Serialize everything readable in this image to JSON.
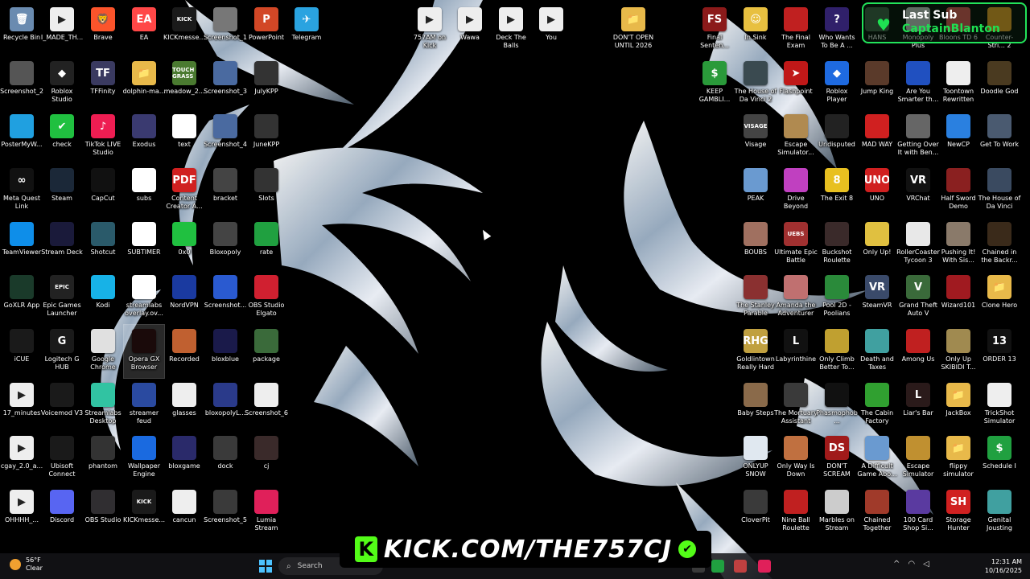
{
  "overlay": {
    "last_sub_title": "Last Sub",
    "last_sub_name": "CaptainBlanton",
    "banner_logo": "K",
    "banner_url": "KICK.COM/THE757CJ"
  },
  "taskbar": {
    "weather_temp": "56°F",
    "weather_cond": "Clear",
    "search_placeholder": "Search",
    "time": "12:31 AM",
    "date": "10/16/2025"
  },
  "colors": {
    "accent_green": "#53fc18",
    "taskbar_bg": "#141418",
    "start_blue": "#4cc2ff"
  },
  "icons": [
    {
      "label": "Recycle Bin",
      "glyph": "🗑",
      "color": "#6a8bb0"
    },
    {
      "label": "I_MADE_TH...",
      "glyph": "▶",
      "color": "#eeeeee"
    },
    {
      "label": "Brave",
      "glyph": "🦁",
      "color": "#fb542b"
    },
    {
      "label": "EA",
      "glyph": "EA",
      "color": "#ff4747"
    },
    {
      "label": "KICKmesse...",
      "glyph": "KICK",
      "color": "#1a1a1a"
    },
    {
      "label": "Screenshot_1",
      "glyph": "",
      "color": "#777777"
    },
    {
      "label": "PowerPoint",
      "glyph": "P",
      "color": "#d24726"
    },
    {
      "label": "Telegram",
      "glyph": "✈",
      "color": "#2aa3e0"
    },
    {
      "label": "757AM on Kick",
      "glyph": "▶",
      "color": "#eeeeee"
    },
    {
      "label": "Wawa",
      "glyph": "▶",
      "color": "#eeeeee"
    },
    {
      "label": "Deck The Balls",
      "glyph": "▶",
      "color": "#eeeeee"
    },
    {
      "label": "You",
      "glyph": "▶",
      "color": "#eeeeee"
    },
    {
      "label": "DON'T OPEN UNTIL 2026",
      "glyph": "📁",
      "color": "#e8b94a"
    },
    {
      "label": "Final Senten...",
      "glyph": "FS",
      "color": "#8b1a1a"
    },
    {
      "label": "In Sink",
      "glyph": "☺",
      "color": "#e8c040"
    },
    {
      "label": "The Final Exam",
      "glyph": "",
      "color": "#c02020"
    },
    {
      "label": "Who Wants To Be A ...",
      "glyph": "?",
      "color": "#30206a"
    },
    {
      "label": "HANS",
      "glyph": "",
      "color": "#3a5a40"
    },
    {
      "label": "Monopoly Plus",
      "glyph": "",
      "color": "#c8c8c8"
    },
    {
      "label": "Bloons TD 6",
      "glyph": "",
      "color": "#e05050"
    },
    {
      "label": "Counter-Stri... 2",
      "glyph": "",
      "color": "#f0a020"
    },
    {
      "label": "Screenshot_2",
      "glyph": "",
      "color": "#555555"
    },
    {
      "label": "Roblox Studio",
      "glyph": "◆",
      "color": "#222222"
    },
    {
      "label": "TFFinity",
      "glyph": "TF",
      "color": "#3a3a60"
    },
    {
      "label": "dolphin-ma...",
      "glyph": "📁",
      "color": "#e8b94a"
    },
    {
      "label": "meadow_2...",
      "glyph": "TOUCH GRASS",
      "color": "#4a7a30"
    },
    {
      "label": "Screenshot_3",
      "glyph": "",
      "color": "#4a6aa0"
    },
    {
      "label": "JulyKPP",
      "glyph": "",
      "color": "#333333"
    },
    {
      "label": "KEEP GAMBLI...",
      "glyph": "$",
      "color": "#2a9a3a"
    },
    {
      "label": "The House of Da Vinci 2",
      "glyph": "",
      "color": "#3a4a50"
    },
    {
      "label": "Flashpoint",
      "glyph": "➤",
      "color": "#c01818"
    },
    {
      "label": "Roblox Player",
      "glyph": "◆",
      "color": "#1e6ae0"
    },
    {
      "label": "Jump King",
      "glyph": "",
      "color": "#5a3a2a"
    },
    {
      "label": "Are You Smarter th...",
      "glyph": "",
      "color": "#2050c0"
    },
    {
      "label": "Toontown Rewritten",
      "glyph": "",
      "color": "#eeeeee"
    },
    {
      "label": "Doodle God",
      "glyph": "",
      "color": "#4a3a20"
    },
    {
      "label": "PosterMyW...",
      "glyph": "",
      "color": "#20a0e0"
    },
    {
      "label": "check",
      "glyph": "✔",
      "color": "#20c040"
    },
    {
      "label": "TikTok LIVE Studio",
      "glyph": "♪",
      "color": "#ee1d52"
    },
    {
      "label": "Exodus",
      "glyph": "",
      "color": "#3a3a70"
    },
    {
      "label": "text",
      "glyph": "",
      "color": "#ffffff"
    },
    {
      "label": "Screenshot_4",
      "glyph": "",
      "color": "#4a6aa0"
    },
    {
      "label": "JuneKPP",
      "glyph": "",
      "color": "#333333"
    },
    {
      "label": "Visage",
      "glyph": "VISAGE",
      "color": "#444444"
    },
    {
      "label": "Escape Simulator...",
      "glyph": "",
      "color": "#b08a50"
    },
    {
      "label": "Undisputed",
      "glyph": "",
      "color": "#222222"
    },
    {
      "label": "MAD WAY",
      "glyph": "",
      "color": "#d02020"
    },
    {
      "label": "Getting Over It with Ben...",
      "glyph": "",
      "color": "#666666"
    },
    {
      "label": "NewCP",
      "glyph": "",
      "color": "#2a80e0"
    },
    {
      "label": "Get To Work",
      "glyph": "",
      "color": "#4a5a70"
    },
    {
      "label": "Meta Quest Link",
      "glyph": "∞",
      "color": "#111111"
    },
    {
      "label": "Steam",
      "glyph": "",
      "color": "#1b2838"
    },
    {
      "label": "CapCut",
      "glyph": "",
      "color": "#111111"
    },
    {
      "label": "subs",
      "glyph": "",
      "color": "#ffffff"
    },
    {
      "label": "Content Creator A...",
      "glyph": "PDF",
      "color": "#d02020"
    },
    {
      "label": "bracket",
      "glyph": "",
      "color": "#444444"
    },
    {
      "label": "Slots",
      "glyph": "",
      "color": "#333333"
    },
    {
      "label": "PEAK",
      "glyph": "",
      "color": "#6a9ad0"
    },
    {
      "label": "Drive Beyond Horizons",
      "glyph": "",
      "color": "#c040c0"
    },
    {
      "label": "The Exit 8",
      "glyph": "8",
      "color": "#e8c020"
    },
    {
      "label": "UNO",
      "glyph": "UNO",
      "color": "#d02020"
    },
    {
      "label": "VRChat",
      "glyph": "VR",
      "color": "#111111"
    },
    {
      "label": "Half Sword Demo",
      "glyph": "",
      "color": "#8a2020"
    },
    {
      "label": "The House of Da Vinci",
      "glyph": "",
      "color": "#3a4a60"
    },
    {
      "label": "TeamViewer",
      "glyph": "",
      "color": "#0e8ee9"
    },
    {
      "label": "Stream Deck",
      "glyph": "",
      "color": "#1a1a3a"
    },
    {
      "label": "Shotcut",
      "glyph": "",
      "color": "#2a5a6a"
    },
    {
      "label": "SUBTIMER",
      "glyph": "",
      "color": "#ffffff"
    },
    {
      "label": "0x0",
      "glyph": "",
      "color": "#20c040"
    },
    {
      "label": "Bloxopoly",
      "glyph": "",
      "color": "#444444"
    },
    {
      "label": "rate",
      "glyph": "",
      "color": "#20a040"
    },
    {
      "label": "BOUBS",
      "glyph": "",
      "color": "#a07060"
    },
    {
      "label": "Ultimate Epic Battle Simu...",
      "glyph": "UEBS",
      "color": "#a03030"
    },
    {
      "label": "Buckshot Roulette",
      "glyph": "",
      "color": "#3a2a2a"
    },
    {
      "label": "Only Up!",
      "glyph": "",
      "color": "#e0c040"
    },
    {
      "label": "RollerCoaster Tycoon 3",
      "glyph": "",
      "color": "#e8e8e8"
    },
    {
      "label": "Pushing It! With Sis...",
      "glyph": "",
      "color": "#8a7a6a"
    },
    {
      "label": "Chained in the Backr...",
      "glyph": "",
      "color": "#3a2a1a"
    },
    {
      "label": "GoXLR App",
      "glyph": "",
      "color": "#1a3a2a"
    },
    {
      "label": "Epic Games Launcher",
      "glyph": "EPIC",
      "color": "#222222"
    },
    {
      "label": "Kodi",
      "glyph": "",
      "color": "#17b2e7"
    },
    {
      "label": "streamlabs overlay.ov...",
      "glyph": "",
      "color": "#ffffff"
    },
    {
      "label": "NordVPN",
      "glyph": "",
      "color": "#1a3aa0"
    },
    {
      "label": "Screenshot...",
      "glyph": "",
      "color": "#2a5ad0"
    },
    {
      "label": "OBS Studio Elgato",
      "glyph": "",
      "color": "#d02030"
    },
    {
      "label": "The Stanley Parable",
      "glyph": "",
      "color": "#8a3030"
    },
    {
      "label": "Amanda the Adventurer",
      "glyph": "",
      "color": "#c07070"
    },
    {
      "label": "Pool 2D - Poolians",
      "glyph": "",
      "color": "#2a8a3a"
    },
    {
      "label": "SteamVR",
      "glyph": "VR",
      "color": "#3a4a6a"
    },
    {
      "label": "Grand Theft Auto V",
      "glyph": "V",
      "color": "#3a6a3a"
    },
    {
      "label": "Wizard101",
      "glyph": "",
      "color": "#a01a20"
    },
    {
      "label": "Clone Hero",
      "glyph": "📁",
      "color": "#e8b94a"
    },
    {
      "label": "iCUE",
      "glyph": "",
      "color": "#1a1a1a"
    },
    {
      "label": "Logitech G HUB",
      "glyph": "G",
      "color": "#1a1a1a"
    },
    {
      "label": "Google Chrome",
      "glyph": "",
      "color": "#e0e0e0"
    },
    {
      "label": "Opera GX Browser",
      "glyph": "",
      "color": "#1a0a0a"
    },
    {
      "label": "Recorded",
      "glyph": "",
      "color": "#c06030"
    },
    {
      "label": "bloxblue",
      "glyph": "",
      "color": "#1a1a4a"
    },
    {
      "label": "package",
      "glyph": "",
      "color": "#3a6a3a"
    },
    {
      "label": "Goldlintown Really Hard ...",
      "glyph": "RHG",
      "color": "#c0a040"
    },
    {
      "label": "Labyrinthine",
      "glyph": "L",
      "color": "#111111"
    },
    {
      "label": "Only Climb Better To...",
      "glyph": "",
      "color": "#c0a030"
    },
    {
      "label": "Death and Taxes",
      "glyph": "",
      "color": "#40a0a0"
    },
    {
      "label": "Among Us",
      "glyph": "",
      "color": "#c02020"
    },
    {
      "label": "Only Up SKIBIDI T...",
      "glyph": "",
      "color": "#a08a50"
    },
    {
      "label": "ORDER 13",
      "glyph": "13",
      "color": "#111111"
    },
    {
      "label": "17_minutes",
      "glyph": "▶",
      "color": "#eeeeee"
    },
    {
      "label": "Voicemod V3",
      "glyph": "",
      "color": "#1a1a1a"
    },
    {
      "label": "Streamlabs Desktop",
      "glyph": "",
      "color": "#31c3a2"
    },
    {
      "label": "streamer feud",
      "glyph": "",
      "color": "#2a4aa0"
    },
    {
      "label": "glasses",
      "glyph": "",
      "color": "#eeeeee"
    },
    {
      "label": "bloxopolyL...",
      "glyph": "",
      "color": "#2a3a8a"
    },
    {
      "label": "Screenshot_6",
      "glyph": "",
      "color": "#eeeeee"
    },
    {
      "label": "Baby Steps",
      "glyph": "",
      "color": "#8a6a4a"
    },
    {
      "label": "The Mortuary Assistant",
      "glyph": "",
      "color": "#3a3a3a"
    },
    {
      "label": "Phasmophob...",
      "glyph": "",
      "color": "#111111"
    },
    {
      "label": "The Cabin Factory",
      "glyph": "",
      "color": "#30a030"
    },
    {
      "label": "Liar's Bar",
      "glyph": "L",
      "color": "#2a1a1a"
    },
    {
      "label": "JackBox",
      "glyph": "📁",
      "color": "#e8b94a"
    },
    {
      "label": "TrickShot Simulator",
      "glyph": "",
      "color": "#eeeeee"
    },
    {
      "label": "cgay_2.0_a...",
      "glyph": "▶",
      "color": "#eeeeee"
    },
    {
      "label": "Ubisoft Connect",
      "glyph": "",
      "color": "#1a1a1a"
    },
    {
      "label": "phantom",
      "glyph": "",
      "color": "#333333"
    },
    {
      "label": "Wallpaper Engine",
      "glyph": "",
      "color": "#1a6ae0"
    },
    {
      "label": "bloxgame",
      "glyph": "",
      "color": "#2a2a6a"
    },
    {
      "label": "dock",
      "glyph": "",
      "color": "#3a3a3a"
    },
    {
      "label": "cj",
      "glyph": "",
      "color": "#3a2a2a"
    },
    {
      "label": "ONLYUP SNOW",
      "glyph": "",
      "color": "#e0e8f0"
    },
    {
      "label": "Only Way Is Down",
      "glyph": "",
      "color": "#c07040"
    },
    {
      "label": "DON'T SCREAM",
      "glyph": "DS",
      "color": "#a01a1a"
    },
    {
      "label": "A Difficult Game Abo...",
      "glyph": "",
      "color": "#6a9ad0"
    },
    {
      "label": "Escape Simulator",
      "glyph": "",
      "color": "#c09030"
    },
    {
      "label": "flippy simulator",
      "glyph": "📁",
      "color": "#e8b94a"
    },
    {
      "label": "Schedule I",
      "glyph": "$",
      "color": "#20a040"
    },
    {
      "label": "OHHHH_...",
      "glyph": "▶",
      "color": "#eeeeee"
    },
    {
      "label": "Discord",
      "glyph": "",
      "color": "#5865f2"
    },
    {
      "label": "OBS Studio",
      "glyph": "",
      "color": "#302e31"
    },
    {
      "label": "KICKmesse...",
      "glyph": "KICK",
      "color": "#1a1a1a"
    },
    {
      "label": "cancun",
      "glyph": "",
      "color": "#eeeeee"
    },
    {
      "label": "Screenshot_5",
      "glyph": "",
      "color": "#3a3a3a"
    },
    {
      "label": "Lumia Stream",
      "glyph": "",
      "color": "#e0205a"
    },
    {
      "label": "CloverPit",
      "glyph": "",
      "color": "#3a3a3a"
    },
    {
      "label": "Nine Ball Roulette",
      "glyph": "",
      "color": "#c02020"
    },
    {
      "label": "Marbles on Stream",
      "glyph": "",
      "color": "#cccccc"
    },
    {
      "label": "Chained Together",
      "glyph": "",
      "color": "#a03a2a"
    },
    {
      "label": "100 Card Shop Si...",
      "glyph": "",
      "color": "#5a3aa0"
    },
    {
      "label": "Storage Hunter",
      "glyph": "SH",
      "color": "#d02020"
    },
    {
      "label": "Genital Jousting",
      "glyph": "",
      "color": "#40a0a0"
    }
  ]
}
